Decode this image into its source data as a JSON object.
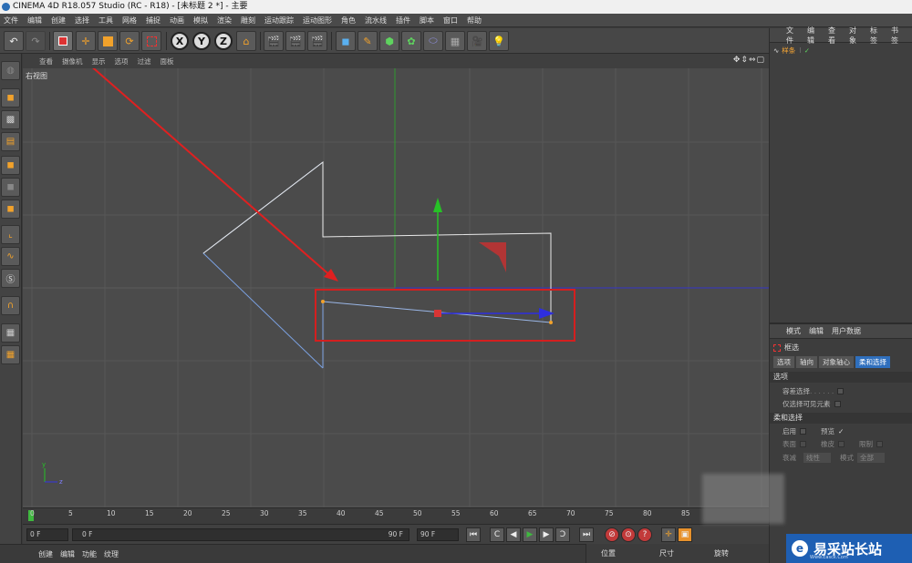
{
  "window": {
    "title": "CINEMA 4D R18.057 Studio (RC - R18) - [未标题 2 *] - 主要"
  },
  "menu": [
    "文件",
    "编辑",
    "创建",
    "选择",
    "工具",
    "网格",
    "捕捉",
    "动画",
    "模拟",
    "渲染",
    "雕刻",
    "运动跟踪",
    "运动图形",
    "角色",
    "流水线",
    "插件",
    "脚本",
    "窗口",
    "帮助"
  ],
  "toolbar": {
    "undo": "↶",
    "axes": [
      "X",
      "Y",
      "Z"
    ]
  },
  "viewport": {
    "menu": [
      "查看",
      "摄像机",
      "显示",
      "选项",
      "过滤",
      "面板"
    ],
    "label": "右视图",
    "nav_icons": "✥⇕⇔▢",
    "axis_y": "y",
    "axis_z": "z",
    "colors": {
      "red_arrow": "#e02020",
      "highlight_box": "#d41f1f",
      "spline": "#e8e8e8",
      "selected_spline": "#7ba1e0"
    }
  },
  "object_manager": {
    "menu": [
      "文件",
      "编辑",
      "查看",
      "对象",
      "标签",
      "书签"
    ],
    "object": "样条"
  },
  "attributes": {
    "menu": [
      "模式",
      "编辑",
      "用户数据"
    ],
    "tool_name": "框选",
    "tabs": [
      "选项",
      "轴向",
      "对象轴心",
      "柔和选择"
    ],
    "selected_tab": "柔和选择",
    "sections": {
      "options": "选项",
      "soft": "柔和选择"
    },
    "rows": {
      "tolerant": "容差选择",
      "visible_only": "仅选择可见元素",
      "enable": "启用",
      "preview": "预览",
      "surface": "表面",
      "rubber": "橡皮",
      "restrict": "限制",
      "falloff": "衰减",
      "falloff_value": "线性",
      "mode": "模式",
      "mode_value": "全部"
    }
  },
  "timeline": {
    "ticks": [
      "0",
      "5",
      "10",
      "15",
      "20",
      "25",
      "30",
      "35",
      "40",
      "45",
      "50",
      "55",
      "60",
      "65",
      "70",
      "75",
      "80",
      "85"
    ]
  },
  "transport": {
    "start": "0 F",
    "range_left": "0 F",
    "range_right": "90 F",
    "end": "90 F"
  },
  "bottom": {
    "menu": [
      "创建",
      "编辑",
      "功能",
      "纹理"
    ],
    "coords": [
      "位置",
      "尺寸",
      "旋转"
    ]
  },
  "watermark": {
    "text": "易采站长站",
    "sub": "Www.Easck.Com"
  }
}
